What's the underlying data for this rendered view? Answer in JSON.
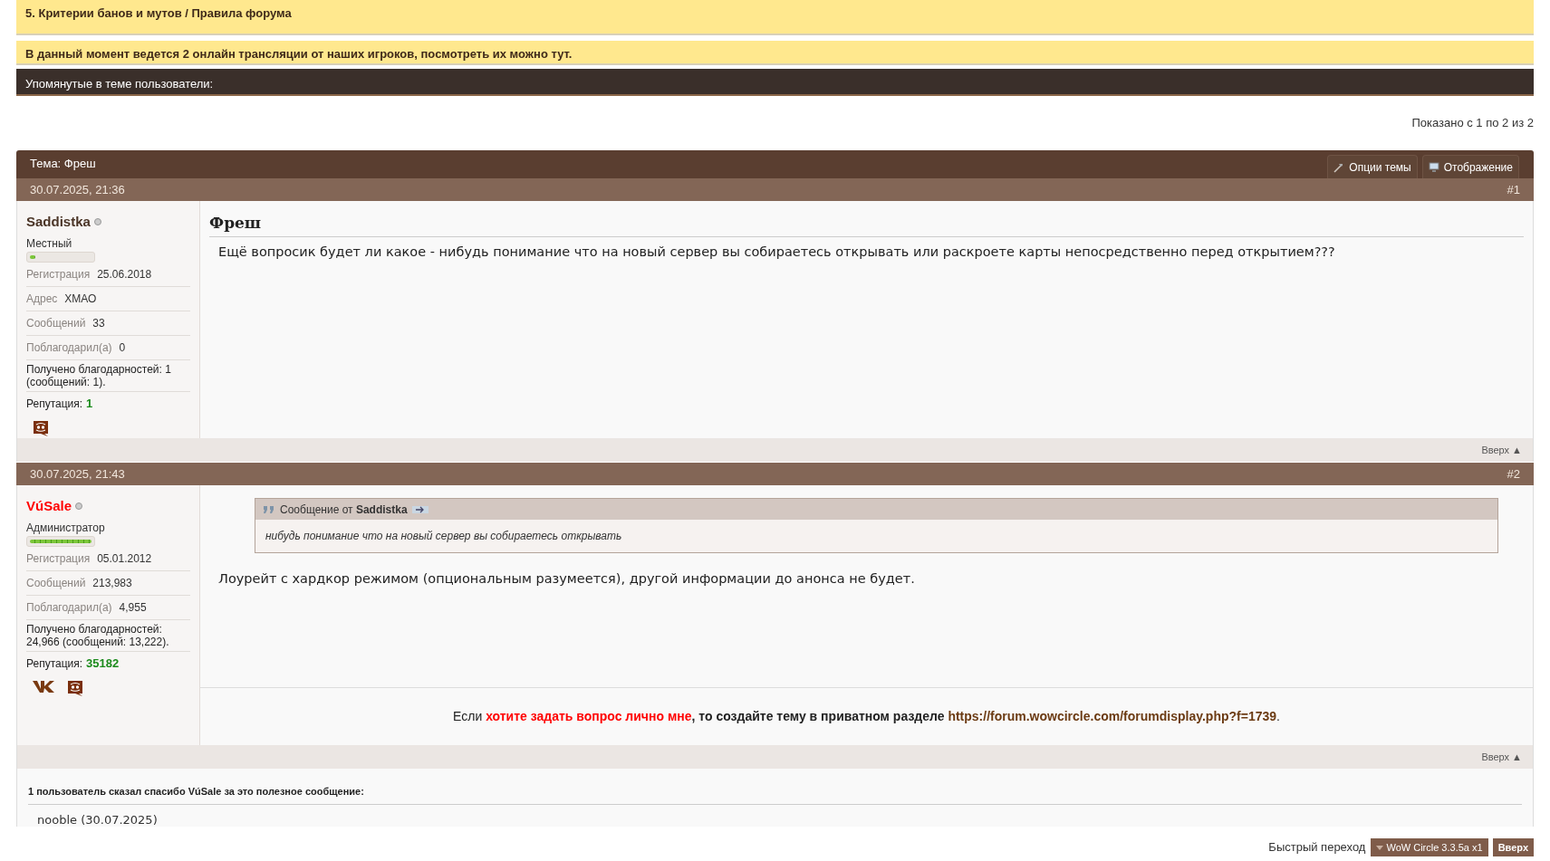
{
  "notices": [
    {
      "text": "5. Критерии банов и мутов / Правила форума"
    },
    {
      "text": "В данный момент ведется 2 онлайн трансляции от наших игроков, посмотреть их можно тут."
    }
  ],
  "mentioned_bar": {
    "label": "Упомянутые в теме пользователи:"
  },
  "pagination_info": "Показано с 1 по 2 из 2",
  "thread": {
    "title": "Тема: Фреш",
    "buttons": [
      {
        "label": "Опции темы",
        "kind": "tools"
      },
      {
        "label": "Отображение",
        "kind": "display"
      }
    ]
  },
  "posts": [
    {
      "date": "30.07.2025, 21:36",
      "number": "#1",
      "user": {
        "name": "Saddistka",
        "color": "#4a3426",
        "online": false,
        "rank": "Местный",
        "level": 0.09,
        "fields": [
          {
            "label": "Регистрация",
            "value": "25.06.2018"
          },
          {
            "label": "Адрес",
            "value": "ХМАО"
          },
          {
            "label": "Сообщений",
            "value": "33"
          },
          {
            "label": "Поблагодарил(а)",
            "value": "0"
          }
        ],
        "thanks": "Получено благодарностей: 1 (сообщений: 1).",
        "reputation_label": "Репутация:",
        "reputation": "1",
        "socials": [
          {
            "kind": "discord"
          }
        ]
      },
      "title": "Фреш",
      "message": "Ещё вопросик будет ли какое - нибудь понимание что на новый сервер вы собираетесь открывать или раскроете карты непосредственно перед открытием???",
      "top_link": "Вверх ▲"
    },
    {
      "date": "30.07.2025, 21:43",
      "number": "#2",
      "user": {
        "name": "VúSale",
        "color": "#ff0000",
        "online": false,
        "rank": "Администратор",
        "level": 1,
        "fields": [
          {
            "label": "Регистрация",
            "value": "05.01.2012"
          },
          {
            "label": "Сообщений",
            "value": "213,983"
          },
          {
            "label": "Поблагодарил(а)",
            "value": "4,955"
          }
        ],
        "thanks": "Получено благодарностей: 24,966 (сообщений: 13,222).",
        "reputation_label": "Репутация:",
        "reputation": "35182",
        "socials": [
          {
            "kind": "vk"
          },
          {
            "kind": "discord"
          }
        ]
      },
      "quote": {
        "header": "Сообщение от **Saddistka**",
        "text": "нибудь понимание что на новый сервер вы собираетесь открывать"
      },
      "message": "Лоурейт с хардкор режимом (опциональным разумеется), другой информации до анонса не будет.",
      "signature": [
        {
          "kind": "plain",
          "text": "Если "
        },
        {
          "kind": "highlight",
          "text": "хотите задать вопрос лично мне"
        },
        {
          "kind": "bold",
          "text": ", то создайте тему в приватном разделе "
        },
        {
          "kind": "link",
          "text": "https://forum.wowcircle.com/forumdisplay.php?f=1739"
        },
        {
          "kind": "plain",
          "text": "."
        }
      ],
      "top_link": "Вверх ▲",
      "thanks_block": {
        "title": "1 пользователь сказал спасибо VúSale за это полезное сообщение:",
        "users": [
          "nooble (30.07.2025)"
        ]
      }
    }
  ],
  "footer": {
    "label": "Быстрый переход",
    "forum_button": "WoW Circle 3.3.5a x1",
    "top_button": "Вверх"
  }
}
